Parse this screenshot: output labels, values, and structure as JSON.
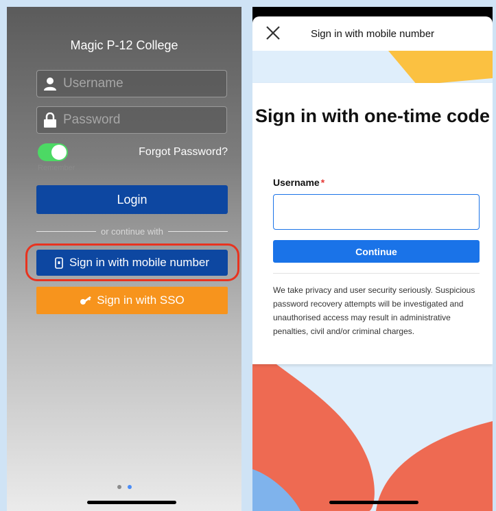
{
  "left_screen": {
    "school_name": "Magic P-12 College",
    "username_placeholder": "Username",
    "password_placeholder": "Password",
    "remember_label": "Remember",
    "remember_on": true,
    "forgot_password": "Forgot Password?",
    "login_label": "Login",
    "divider_text": "or continue with",
    "mobile_button": "Sign in with mobile number",
    "sso_button": "Sign in with SSO",
    "page_indicator": {
      "count": 2,
      "active_index": 1
    }
  },
  "right_screen": {
    "header_title": "Sign in with mobile number",
    "heading": "Sign in with one-time code",
    "username_label": "Username",
    "required_mark": "*",
    "continue_label": "Continue",
    "notice": "We take privacy and user security seriously. Suspicious password recovery attempts will be investigated and unauthorised access may result in administrative penalties, civil and/or criminal charges."
  },
  "colors": {
    "primary_blue": "#0d47a1",
    "sso_orange": "#f7941d",
    "highlight_red": "#e8331f",
    "continue_blue": "#1a73e8",
    "toggle_green": "#4cd964",
    "wave_coral": "#ee6a52",
    "wave_yellow": "#fbc141"
  }
}
